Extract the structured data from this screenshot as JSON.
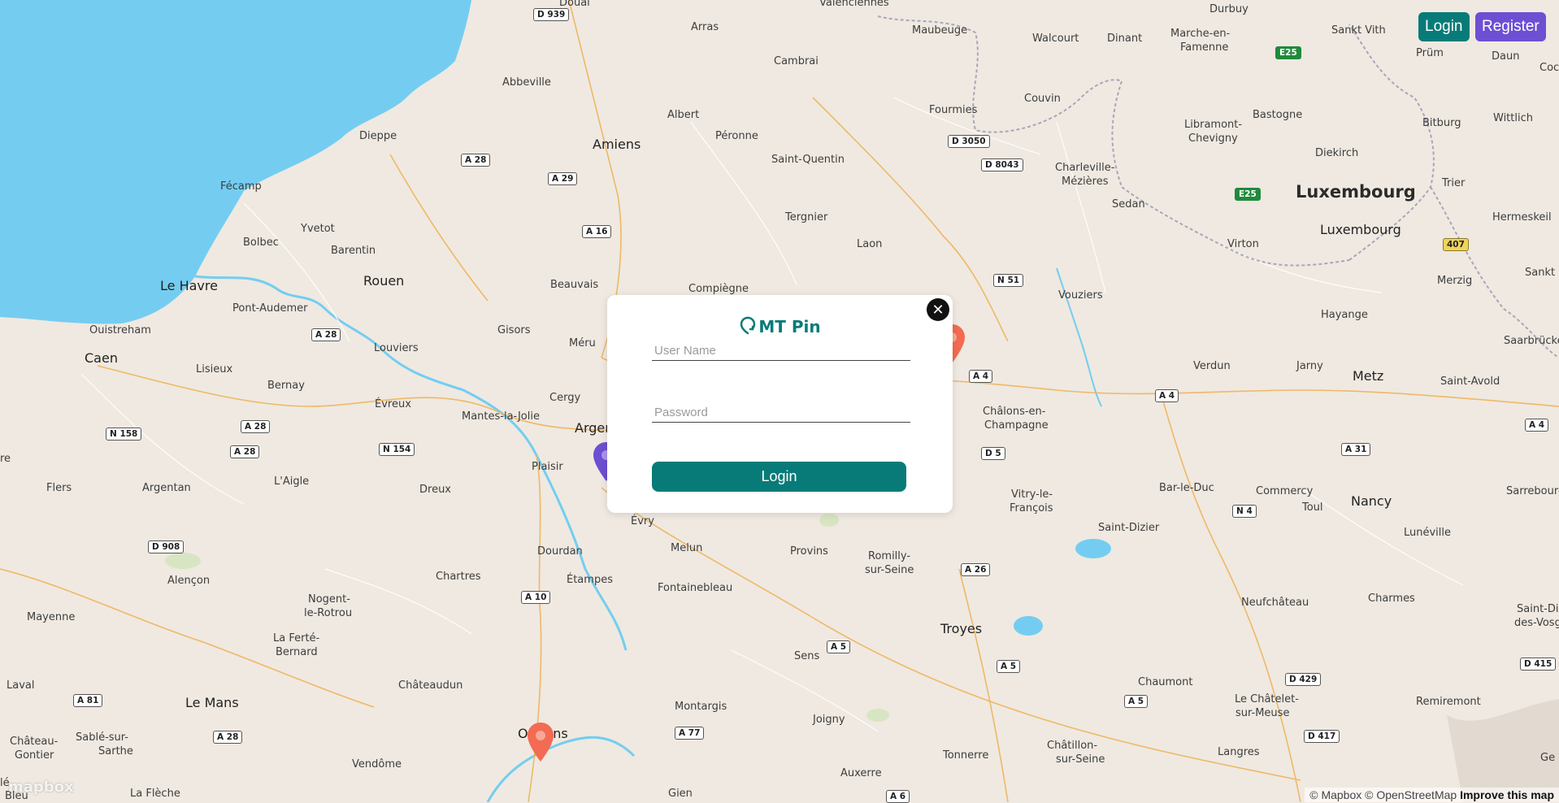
{
  "header": {
    "login_label": "Login",
    "register_label": "Register"
  },
  "modal": {
    "brand": "MT Pin",
    "username_placeholder": "User Name",
    "password_placeholder": "Password",
    "submit_label": "Login",
    "close_symbol": "✕"
  },
  "map": {
    "logo": "mapbox",
    "attribution_left": "© Mapbox © OpenStreetMap",
    "attribution_improve": "Improve this map",
    "places": {
      "douai": "Douai",
      "valenciennes": "Valenciennes",
      "durbuy": "Durbuy",
      "arras": "Arras",
      "maubeuge": "Maubeuge",
      "walcourt": "Walcourt",
      "dinant": "Dinant",
      "marche": "Marche-en-",
      "famenne": "Famenne",
      "sankt_vith": "Sankt Vith",
      "cambrai": "Cambrai",
      "prum": "Prüm",
      "daun": "Daun",
      "coc": "Coc",
      "abbeville": "Abbeville",
      "couvin": "Couvin",
      "bastogne": "Bastogne",
      "albert": "Albert",
      "fourmies": "Fourmies",
      "bitburg": "Bitburg",
      "wittlich": "Wittlich",
      "amiens": "Amiens",
      "peronne": "Péronne",
      "dieppe": "Dieppe",
      "libramont": "Libramont-",
      "chevigny": "Chevigny",
      "saint_quentin": "Saint-Quentin",
      "diekirch": "Diekirch",
      "fecamp": "Fécamp",
      "charleville": "Charleville-",
      "mezieres": "Mézières",
      "luxembourg_country": "Luxembourg",
      "trier": "Trier",
      "yvetot": "Yvetot",
      "tergnier": "Tergnier",
      "sedan": "Sedan",
      "hermeskeil": "Hermeskeil",
      "bolbec": "Bolbec",
      "barentin": "Barentin",
      "laon": "Laon",
      "virton": "Virton",
      "luxembourg_city": "Luxembourg",
      "sankt": "Sankt",
      "le_havre": "Le Havre",
      "rouen": "Rouen",
      "beauvais": "Beauvais",
      "compiegne": "Compiègne",
      "merzig": "Merzig",
      "pont_audemer": "Pont-Audemer",
      "vouziers": "Vouziers",
      "hayange": "Hayange",
      "ouistreham": "Ouistreham",
      "gisors": "Gisors",
      "saarbrucken": "Saarbrücken",
      "caen": "Caen",
      "louviers": "Louviers",
      "meru": "Méru",
      "lisieux": "Lisieux",
      "verdun": "Verdun",
      "jarny": "Jarny",
      "metz": "Metz",
      "bernay": "Bernay",
      "saint_avold": "Saint-Avold",
      "cergy": "Cergy",
      "evreux": "Évreux",
      "mantes": "Mantes-la-Jolie",
      "chalons": "Châlons-en-",
      "champagne": "Champagne",
      "argenteuil": "Argenteuil",
      "plaisir": "Plaisir",
      "bar_le_duc": "Bar-le-Duc",
      "flers": "Flers",
      "argentan": "Argentan",
      "laigle": "L'Aigle",
      "dreux": "Dreux",
      "vitry": "Vitry-le-",
      "francois": "François",
      "commercy": "Commercy",
      "nancy": "Nancy",
      "sarrebourg": "Sarrebourg",
      "evry": "Évry",
      "saint_dizier": "Saint-Dizier",
      "toul": "Toul",
      "luneville": "Lunéville",
      "dourdan": "Dourdan",
      "melun": "Melun",
      "provins": "Provins",
      "romilly": "Romilly-",
      "sur_seine": "sur-Seine",
      "alencon": "Alençon",
      "chartres": "Chartres",
      "etampes": "Étampes",
      "fontainebleau": "Fontainebleau",
      "nogent": "Nogent-",
      "le_rotrou": "le-Rotrou",
      "neufchateau": "Neufchâteau",
      "charmes": "Charmes",
      "saint_die": "Saint-Dié-",
      "des_vosges": "des-Vosges",
      "mayenne": "Mayenne",
      "troyes": "Troyes",
      "la_ferte": "La Ferté-",
      "bernard": "Bernard",
      "sens": "Sens",
      "chaumont": "Chaumont",
      "laval": "Laval",
      "chateaudun": "Châteaudun",
      "montargis": "Montargis",
      "le_chatelet": "Le Châtelet-",
      "sur_meuse": "sur-Meuse",
      "remiremont": "Remiremont",
      "le_mans": "Le Mans",
      "joigny": "Joigny",
      "chateau_gontier": "Château-",
      "gontier": "Gontier",
      "sable": "Sablé-sur-",
      "sarthe": "Sarthe",
      "orleans": "Orléans",
      "tonnerre": "Tonnerre",
      "langres": "Langres",
      "chatillon": "Châtillon-",
      "chatillon_seine": "sur-Seine",
      "vendome": "Vendôme",
      "auxerre": "Auxerre",
      "la_fleche": "La Flèche",
      "gien": "Gien",
      "ge": "Ge",
      "bleu": "Bleu",
      "re": "re",
      "le": "lé"
    },
    "roads": {
      "d939": "D 939",
      "a28a": "A 28",
      "a29": "A 29",
      "a16": "A 16",
      "d3050": "D 3050",
      "d8043": "D 8043",
      "e25a": "E25",
      "e25b": "E25",
      "n51": "N 51",
      "r407": "407",
      "a28b": "A 28",
      "a28c": "A 28",
      "a28d": "A 28",
      "n158": "N 158",
      "n154": "N 154",
      "a4a": "A 4",
      "a4b": "A 4",
      "a4c": "A 4",
      "d5": "D 5",
      "a31": "A 31",
      "n4": "N 4",
      "d908": "D 908",
      "a26": "A 26",
      "a10": "A 10",
      "a5a": "A 5",
      "a5b": "A 5",
      "a5c": "A 5",
      "d415": "D 415",
      "d429": "D 429",
      "a81": "A 81",
      "a28e": "A 28",
      "a77": "A 77",
      "d417": "D 417",
      "a6": "A 6"
    },
    "colors": {
      "water": "#74cdf1",
      "land": "#efe9e1",
      "pin_red": "#f36b52",
      "pin_purple": "#6c4fd3",
      "accent": "#087b78"
    }
  }
}
